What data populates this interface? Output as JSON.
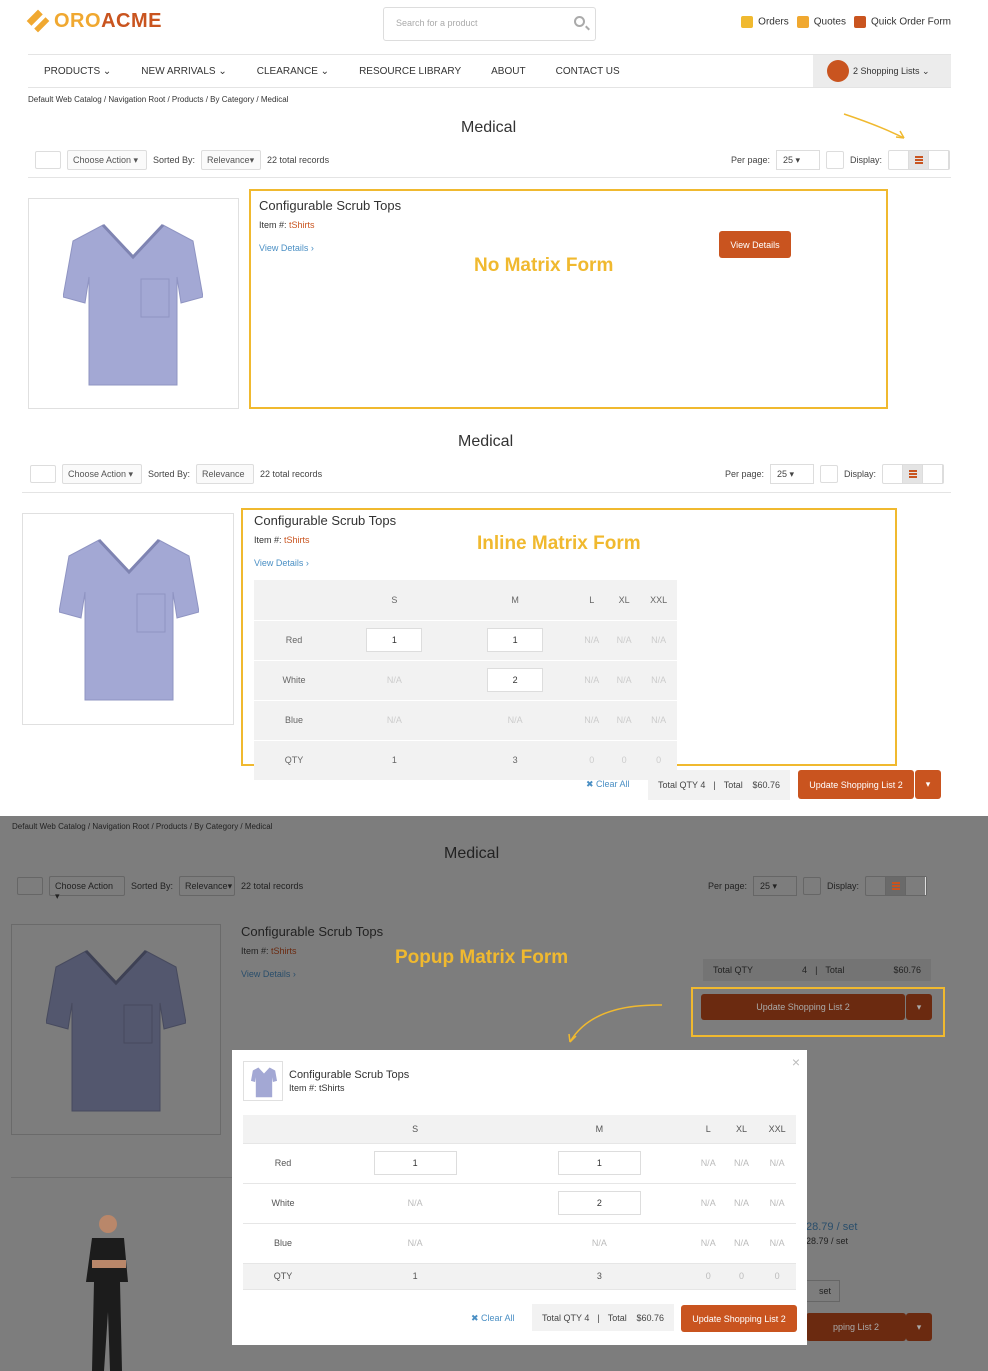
{
  "header": {
    "logo_a": "ORO",
    "logo_b": "ACME",
    "search_placeholder": "Search for a product",
    "links": [
      "Orders",
      "Quotes",
      "Quick Order Form"
    ]
  },
  "nav": {
    "items": [
      "PRODUCTS",
      "NEW ARRIVALS",
      "CLEARANCE",
      "RESOURCE LIBRARY",
      "ABOUT",
      "CONTACT US"
    ],
    "shopping_lists": "2 Shopping Lists"
  },
  "breadcrumb": "Default Web Catalog / Navigation Root / Products / By Category / Medical",
  "page_title": "Medical",
  "toolbar": {
    "choose_action": "Choose Action",
    "sorted_by": "Sorted By:",
    "relevance": "Relevance",
    "records": "22 total records",
    "per_page": "Per page:",
    "per_page_value": "25",
    "display": "Display:"
  },
  "product": {
    "title": "Configurable Scrub Tops",
    "item_label": "Item #:",
    "item_value": "tShirts",
    "view_details": "View Details",
    "view_details_button": "View Details"
  },
  "labels": {
    "no_matrix": "No Matrix Form",
    "inline_matrix": "Inline Matrix Form",
    "popup_matrix": "Popup Matrix Form"
  },
  "matrix": {
    "sizes": [
      "S",
      "M",
      "L",
      "XL",
      "XXL"
    ],
    "rows": [
      {
        "color": "Red",
        "cells": [
          "1",
          "1",
          "N/A",
          "N/A",
          "N/A"
        ]
      },
      {
        "color": "White",
        "cells": [
          "N/A",
          "2",
          "N/A",
          "N/A",
          "N/A"
        ]
      },
      {
        "color": "Blue",
        "cells": [
          "N/A",
          "N/A",
          "N/A",
          "N/A",
          "N/A"
        ]
      }
    ],
    "qty_label": "QTY",
    "qty": [
      "1",
      "3",
      "0",
      "0",
      "0"
    ]
  },
  "totals": {
    "clear_all": "Clear All",
    "total_qty": "Total QTY 4",
    "total_label": "Total",
    "total_value": "$60.76",
    "update_button": "Update Shopping List 2",
    "total_qty_label": "Total QTY",
    "total_qty_num": "4"
  },
  "bg_prices": [
    "28.79 / set",
    "28.79 / set",
    "set",
    "pping List 2"
  ]
}
